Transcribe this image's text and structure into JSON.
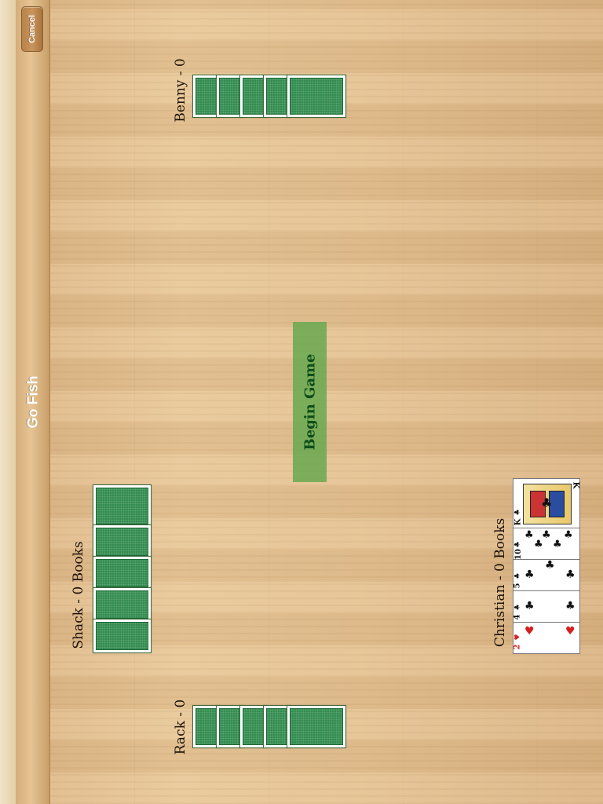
{
  "nav": {
    "title": "Go Fish",
    "cancel_label": "Cancel"
  },
  "players": {
    "top": {
      "label": "Benny - 0",
      "card_count": 5
    },
    "left": {
      "label": "Shack - 0 Books",
      "card_count": 5
    },
    "bottom": {
      "label": "Rack - 0",
      "card_count": 5
    },
    "user": {
      "label": "Christian - 0 Books",
      "cards": [
        {
          "rank": "2",
          "suit": "hearts"
        },
        {
          "rank": "4",
          "suit": "clubs"
        },
        {
          "rank": "5",
          "suit": "clubs"
        },
        {
          "rank": "10",
          "suit": "clubs"
        },
        {
          "rank": "K",
          "suit": "clubs"
        }
      ]
    }
  },
  "begin_button_label": "Begin Game",
  "colors": {
    "felt_card_back": "#2f8a4d",
    "button_green": "#67a850",
    "button_text": "#0d4f1b"
  },
  "icons": {
    "hearts": "♥",
    "clubs": "♣"
  }
}
